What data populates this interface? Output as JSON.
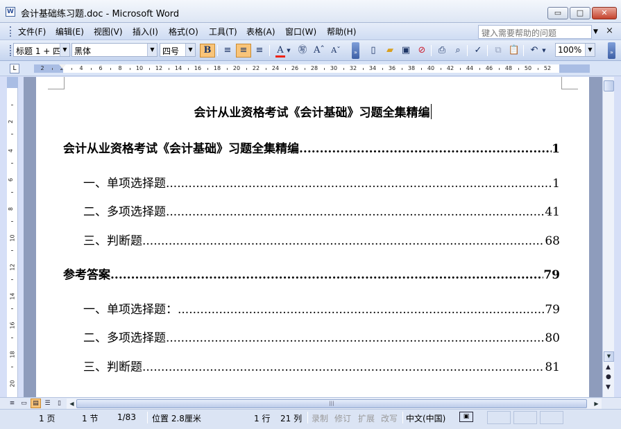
{
  "window": {
    "title": "会计基础练习题.doc - Microsoft Word",
    "app_icon": "W",
    "buttons": {
      "minimize": "▭",
      "maximize": "□",
      "close": "✕"
    }
  },
  "menu": {
    "items": [
      "文件(F)",
      "编辑(E)",
      "视图(V)",
      "插入(I)",
      "格式(O)",
      "工具(T)",
      "表格(A)",
      "窗口(W)",
      "帮助(H)"
    ],
    "help_placeholder": "键入需要帮助的问题",
    "doc_close": "×"
  },
  "toolbar": {
    "style_value": "标题 1 + 四",
    "font_value": "黑体",
    "size_value": "四号",
    "bold_label": "B",
    "zoom_value": "100%",
    "icons": [
      "bold-icon",
      "align-justify-icon",
      "align-center-icon",
      "align-right-icon",
      "font-color-icon",
      "phonetic-icon",
      "grow-font-icon",
      "shrink-font-icon",
      "new-doc-icon",
      "open-icon",
      "save-icon",
      "permission-icon",
      "print-icon",
      "print-preview-icon",
      "spelling-icon",
      "copy-icon",
      "paste-icon",
      "undo-icon"
    ]
  },
  "ruler": {
    "tab_selector": "L",
    "labels": [
      "2",
      "2",
      "4",
      "6",
      "8",
      "10",
      "12",
      "14",
      "16",
      "18",
      "20",
      "22",
      "24",
      "26",
      "28",
      "30",
      "32",
      "34",
      "36",
      "38",
      "40",
      "42",
      "44",
      "46",
      "48",
      "50",
      "52"
    ],
    "vertical_labels": [
      "2",
      "4",
      "6",
      "8",
      "10",
      "12",
      "14",
      "16",
      "18",
      "20"
    ]
  },
  "document": {
    "title": "会计从业资格考试《会计基础》习题全集精编",
    "toc": [
      {
        "text": "会计从业资格考试《会计基础》习题全集精编",
        "page": "1",
        "level": 1
      },
      {
        "text": "一、单项选择题",
        "page": "1",
        "level": 2
      },
      {
        "text": "二、多项选择题",
        "page": "41",
        "level": 2
      },
      {
        "text": "三、判断题",
        "page": "68",
        "level": 2
      },
      {
        "text": "参考答案",
        "page": "79",
        "level": 1
      },
      {
        "text": "一、单项选择题：",
        "page": "79",
        "level": 2
      },
      {
        "text": "二、多项选择题",
        "page": "80",
        "level": 2
      },
      {
        "text": "三、判断题",
        "page": "81",
        "level": 2
      }
    ]
  },
  "statusbar": {
    "page": "1 页",
    "section": "1 节",
    "page_of": "1/83",
    "position": "位置 2.8厘米",
    "line": "1 行",
    "column": "21 列",
    "rec": "录制",
    "trk": "修订",
    "ext": "扩展",
    "ovr": "改写",
    "language": "中文(中国)",
    "spelling_icon": "▣"
  },
  "colors": {
    "titlebar": "#dde6f4",
    "toolbar": "#c6d5ef",
    "active_button": "#f9c479",
    "workspace": "#8e9cbc"
  }
}
